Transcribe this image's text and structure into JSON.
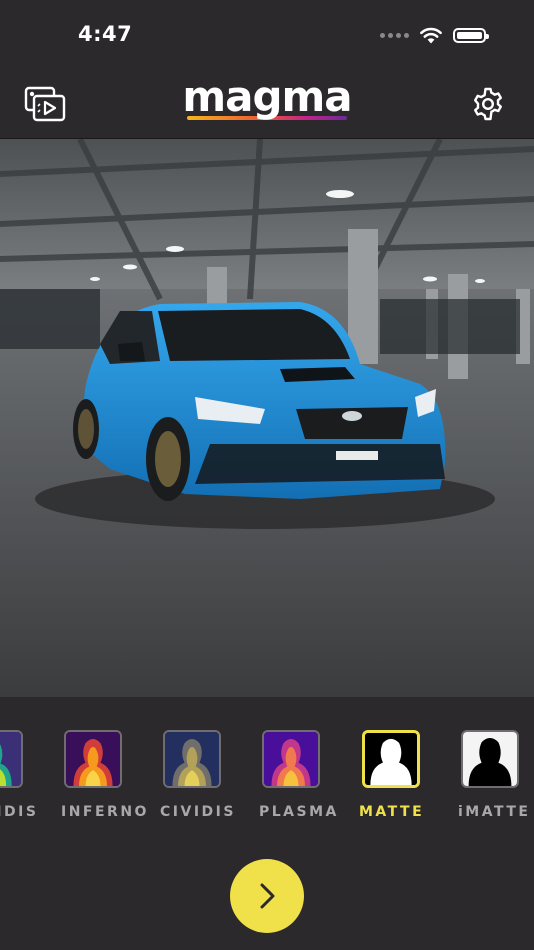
{
  "status": {
    "time": "4:47"
  },
  "header": {
    "logo": "magma"
  },
  "filters": [
    {
      "label": "VIRIDIS",
      "selected": false
    },
    {
      "label": "INFERNO",
      "selected": false
    },
    {
      "label": "CIVIDIS",
      "selected": false
    },
    {
      "label": "PLASMA",
      "selected": false
    },
    {
      "label": "MATTE",
      "selected": true
    },
    {
      "label": "iMATTE",
      "selected": false
    }
  ],
  "colors": {
    "accent": "#f0e14a",
    "background": "#2b292b",
    "car": "#1e8fd8"
  },
  "icons": {
    "gallery": "photo-video-gallery-icon",
    "settings": "gear-icon",
    "next": "chevron-right-icon"
  }
}
